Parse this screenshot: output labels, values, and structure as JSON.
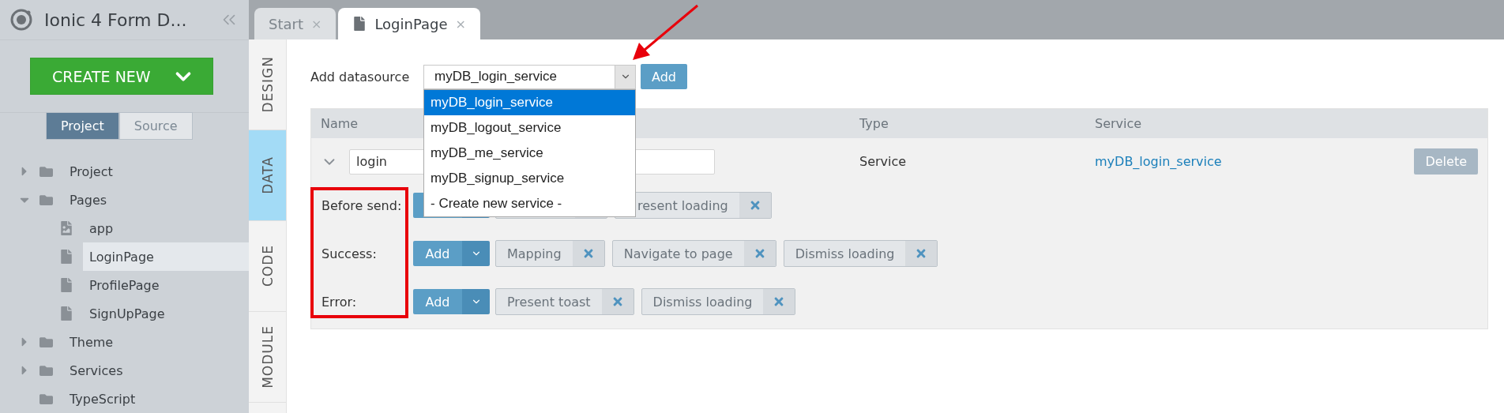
{
  "sidebar": {
    "title": "Ionic 4 Form D...",
    "create_button": "CREATE NEW",
    "view_tabs": [
      {
        "label": "Project",
        "selected": true
      },
      {
        "label": "Source",
        "selected": false
      }
    ],
    "tree": [
      {
        "label": "Project",
        "kind": "folder",
        "expanded": false,
        "selected": false
      },
      {
        "label": "Pages",
        "kind": "folder",
        "expanded": true,
        "selected": false,
        "children": [
          {
            "label": "app",
            "kind": "image-file",
            "selected": false
          },
          {
            "label": "LoginPage",
            "kind": "file",
            "selected": true
          },
          {
            "label": "ProfilePage",
            "kind": "file",
            "selected": false
          },
          {
            "label": "SignUpPage",
            "kind": "file",
            "selected": false
          }
        ]
      },
      {
        "label": "Theme",
        "kind": "folder",
        "expanded": false,
        "selected": false
      },
      {
        "label": "Services",
        "kind": "folder",
        "expanded": false,
        "selected": false
      },
      {
        "label": "TypeScript",
        "kind": "plain-folder",
        "selected": false
      }
    ]
  },
  "editor_tabs": [
    {
      "label": "Start",
      "close": "×",
      "selected": false
    },
    {
      "label": "LoginPage",
      "close": "×",
      "selected": true
    }
  ],
  "side_tabs": [
    {
      "label": "DESIGN",
      "selected": false
    },
    {
      "label": "DATA",
      "selected": true
    },
    {
      "label": "CODE",
      "selected": false
    },
    {
      "label": "MODULE",
      "selected": false
    }
  ],
  "datasource": {
    "label": "Add datasource",
    "value": "myDB_login_service",
    "open": true,
    "add_button": "Add",
    "options": [
      {
        "label": "myDB_login_service",
        "selected": true
      },
      {
        "label": "myDB_logout_service",
        "selected": false
      },
      {
        "label": "myDB_me_service",
        "selected": false
      },
      {
        "label": "myDB_signup_service",
        "selected": false
      },
      {
        "label": "- Create new service -",
        "selected": false
      }
    ]
  },
  "table": {
    "columns": [
      "Name",
      "Type",
      "Service"
    ],
    "rows": [
      {
        "expanded": true,
        "name": "login",
        "type": "Service",
        "service": "myDB_login_service",
        "delete_button": "Delete",
        "events": [
          {
            "label": "Before send:",
            "actions": [
              {
                "kind": "hidden"
              },
              {
                "kind": "partial",
                "label": "resent loading"
              }
            ]
          },
          {
            "label": "Success:",
            "add_button": "Add",
            "actions": [
              {
                "kind": "tag",
                "label": "Mapping"
              },
              {
                "kind": "tag",
                "label": "Navigate to page"
              },
              {
                "kind": "tag",
                "label": "Dismiss loading"
              }
            ]
          },
          {
            "label": "Error:",
            "add_button": "Add",
            "actions": [
              {
                "kind": "tag",
                "label": "Present toast"
              },
              {
                "kind": "tag",
                "label": "Dismiss loading"
              }
            ]
          }
        ]
      }
    ]
  },
  "annotations": {
    "box": true,
    "arrow": true
  }
}
